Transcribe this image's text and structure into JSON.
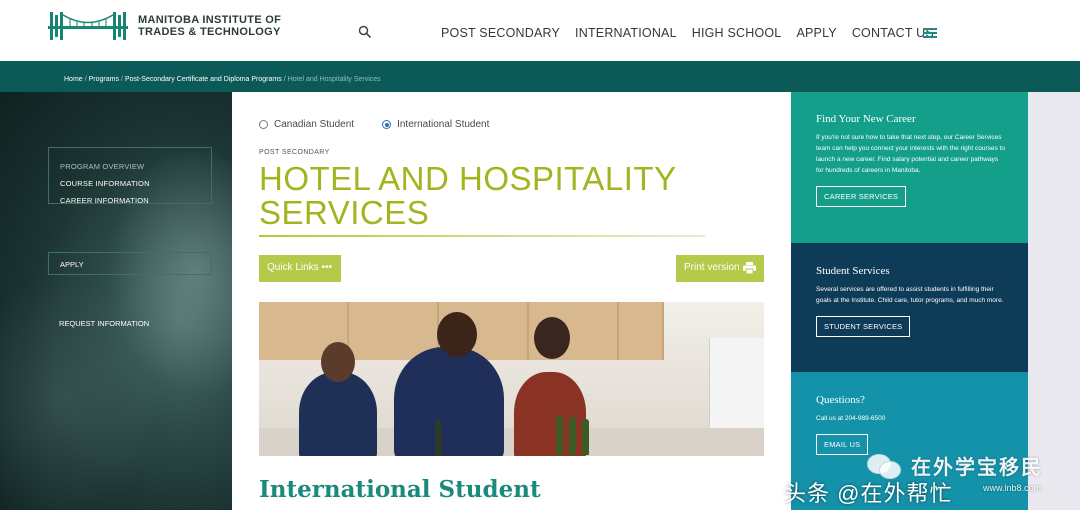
{
  "header": {
    "logo_line1": "MANITOBA INSTITUTE OF",
    "logo_line2": "TRADES & TECHNOLOGY",
    "nav": [
      "POST SECONDARY",
      "INTERNATIONAL",
      "HIGH SCHOOL",
      "APPLY",
      "CONTACT US"
    ]
  },
  "breadcrumb": {
    "items": [
      "Home",
      "Programs",
      "Post-Secondary Certificate and Diploma Programs"
    ],
    "current": "Hotel and Hospitality Services",
    "separator": "/"
  },
  "left_nav": {
    "overview": "PROGRAM OVERVIEW",
    "course": "COURSE INFORMATION",
    "career": "CAREER INFORMATION",
    "apply": "APPLY",
    "request": "REQUEST INFORMATION"
  },
  "main": {
    "radio_canadian": "Canadian Student",
    "radio_international": "International Student",
    "selected_radio": "International Student",
    "eyebrow": "POST SECONDARY",
    "title": "HOTEL AND HOSPITALITY SERVICES",
    "quick_links": "Quick Links •••",
    "print_version": "Print version",
    "subtitle": "International Student"
  },
  "sidebar": {
    "card1": {
      "title": "Find Your New Career",
      "text": "If you're not sure how to take that next step, our Career Services team can help you connect your interests with the right courses to launch a new career. Find salary potential and career pathways for hundreds of careers in Manitoba.",
      "button": "CAREER SERVICES",
      "color": "#139f8a"
    },
    "card2": {
      "title": "Student Services",
      "text": "Several services are offered to assist students in fulfilling their goals at the Institute. Child care, tutor programs, and much more.",
      "button": "STUDENT SERVICES",
      "color": "#0e3b58"
    },
    "card3": {
      "title": "Questions?",
      "text": "Call us at 204-989-6500",
      "button": "EMAIL US",
      "color": "#1492aa"
    }
  },
  "colors": {
    "accent_green": "#a4b41f",
    "button_green": "#b6c94a",
    "dark_teal": "#0c5a58",
    "subtitle_teal": "#1a8a7c"
  },
  "watermarks": {
    "wechat": "在外学宝移民",
    "url": "www.lnb8.com",
    "toutiao": "头条 @在外帮忙"
  }
}
